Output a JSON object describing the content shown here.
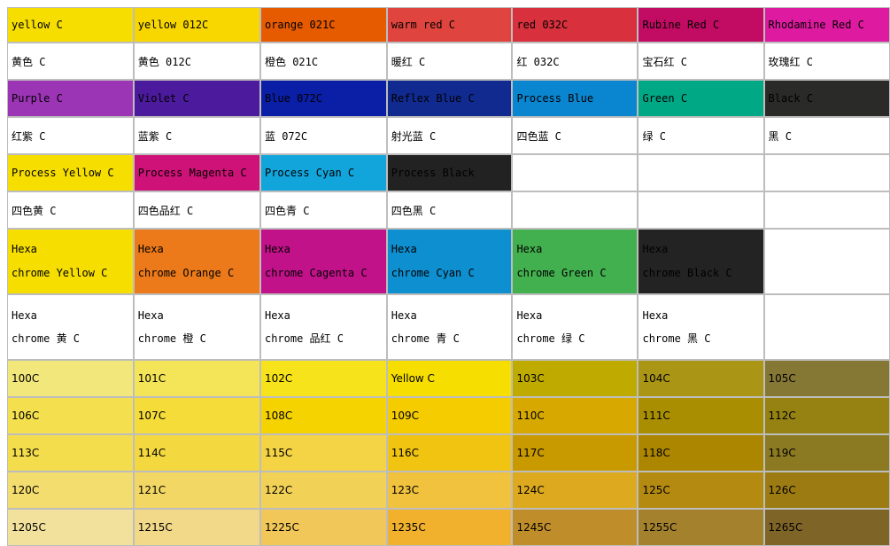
{
  "rows": [
    {
      "kind": "swatch",
      "h": 38,
      "cells": [
        {
          "text": "yellow C",
          "bg": "#f6de00"
        },
        {
          "text": "yellow 012C",
          "bg": "#f8d700"
        },
        {
          "text": "orange 021C",
          "bg": "#e65a00"
        },
        {
          "text": "warm red C",
          "bg": "#e0443e"
        },
        {
          "text": "red 032C",
          "bg": "#d9303d"
        },
        {
          "text": "Rubine Red C",
          "bg": "#c20b63"
        },
        {
          "text": "Rhodamine Red C",
          "bg": "#de1aa0"
        }
      ]
    },
    {
      "kind": "label",
      "h": 40,
      "cells": [
        {
          "text": "黄色 C"
        },
        {
          "text": "黄色 012C"
        },
        {
          "text": "橙色 021C"
        },
        {
          "text": "暖红 C"
        },
        {
          "text": "红 032C"
        },
        {
          "text": "宝石红 C"
        },
        {
          "text": "玫瑰红 C"
        }
      ]
    },
    {
      "kind": "swatch",
      "h": 40,
      "cells": [
        {
          "text": "Purple C",
          "bg": "#9c35b5"
        },
        {
          "text": "Violet C",
          "bg": "#4c1a9c"
        },
        {
          "text": "Blue 072C",
          "bg": "#0b1ea6"
        },
        {
          "text": "Reflex Blue C",
          "bg": "#102a8f"
        },
        {
          "text": "Process Blue",
          "bg": "#0a85cf"
        },
        {
          "text": "Green C",
          "bg": "#00a886"
        },
        {
          "text": "Black C",
          "bg": "#2a2a28"
        }
      ]
    },
    {
      "kind": "label",
      "h": 40,
      "cells": [
        {
          "text": "红紫 C"
        },
        {
          "text": "蓝紫 C"
        },
        {
          "text": "蓝 072C"
        },
        {
          "text": "射光蓝 C"
        },
        {
          "text": "四色蓝 C"
        },
        {
          "text": "绿 C"
        },
        {
          "text": "黑 C"
        }
      ]
    },
    {
      "kind": "swatch",
      "h": 40,
      "cells": [
        {
          "text": "Process Yellow C",
          "bg": "#f6de00"
        },
        {
          "text": "Process Magenta C",
          "bg": "#cf1277"
        },
        {
          "text": "Process Cyan C",
          "bg": "#12a5dc"
        },
        {
          "text": "Process Black",
          "bg": "#222222"
        },
        {
          "text": "",
          "bg": ""
        },
        {
          "text": "",
          "bg": ""
        },
        {
          "text": "",
          "bg": ""
        }
      ]
    },
    {
      "kind": "label",
      "h": 40,
      "cells": [
        {
          "text": "四色黄 C"
        },
        {
          "text": "四色品红 C"
        },
        {
          "text": "四色青 C"
        },
        {
          "text": "四色黑 C"
        },
        {
          "text": ""
        },
        {
          "text": ""
        },
        {
          "text": ""
        }
      ]
    },
    {
      "kind": "tall",
      "h": 72,
      "cells": [
        {
          "text": "Hexa\nchrome Yellow C",
          "bg": "#f6de00"
        },
        {
          "text": "Hexa\nchrome Orange C",
          "bg": "#ec7a1a"
        },
        {
          "text": "Hexa\nchrome Cagenta C",
          "bg": "#c2128a"
        },
        {
          "text": "Hexa\nchrome Cyan C",
          "bg": "#0e8fd0"
        },
        {
          "text": "Hexa\nchrome Green C",
          "bg": "#43b04f"
        },
        {
          "text": "Hexa\nchrome Black C",
          "bg": "#232323"
        },
        {
          "text": "",
          "bg": ""
        }
      ]
    },
    {
      "kind": "tall-lbl",
      "h": 72,
      "cells": [
        {
          "text": "Hexa\nchrome 黄 C"
        },
        {
          "text": "Hexa\nchrome 橙 C"
        },
        {
          "text": "Hexa\nchrome 品红 C"
        },
        {
          "text": "Hexa\nchrome 青 C"
        },
        {
          "text": "Hexa\nchrome 绿 C"
        },
        {
          "text": "Hexa\nchrome 黑 C"
        },
        {
          "text": ""
        }
      ]
    },
    {
      "kind": "code",
      "h": 40,
      "cells": [
        {
          "text": "100C",
          "bg": "#f2e77a"
        },
        {
          "text": "101C",
          "bg": "#f4e458"
        },
        {
          "text": "102C",
          "bg": "#f6e31c"
        },
        {
          "text": "Yellow C",
          "bg": "#f6de00"
        },
        {
          "text": "103C",
          "bg": "#bfaa00"
        },
        {
          "text": "104C",
          "bg": "#ab9514"
        },
        {
          "text": "105C",
          "bg": "#857734"
        }
      ]
    },
    {
      "kind": "code",
      "h": 40,
      "cells": [
        {
          "text": "106C",
          "bg": "#f4e04e"
        },
        {
          "text": "107C",
          "bg": "#f5dc38"
        },
        {
          "text": "108C",
          "bg": "#f5d300"
        },
        {
          "text": "109C",
          "bg": "#f5cc00"
        },
        {
          "text": "110C",
          "bg": "#d7a900"
        },
        {
          "text": "111C",
          "bg": "#a88e00"
        },
        {
          "text": "112C",
          "bg": "#958213"
        }
      ]
    },
    {
      "kind": "code",
      "h": 40,
      "cells": [
        {
          "text": "113C",
          "bg": "#f4dd4c"
        },
        {
          "text": "114C",
          "bg": "#f4d840"
        },
        {
          "text": "115C",
          "bg": "#f4d345"
        },
        {
          "text": "116C",
          "bg": "#f2c412"
        },
        {
          "text": "117C",
          "bg": "#c99a00"
        },
        {
          "text": "118C",
          "bg": "#ad8600"
        },
        {
          "text": "119C",
          "bg": "#8c7a22"
        }
      ]
    },
    {
      "kind": "code",
      "h": 40,
      "cells": [
        {
          "text": "120C",
          "bg": "#f3dd6e"
        },
        {
          "text": "121C",
          "bg": "#f3d764"
        },
        {
          "text": "122C",
          "bg": "#f2d157"
        },
        {
          "text": "123C",
          "bg": "#f1c23e"
        },
        {
          "text": "124C",
          "bg": "#dca91f"
        },
        {
          "text": "125C",
          "bg": "#b48a10"
        },
        {
          "text": "126C",
          "bg": "#9c7c12"
        }
      ]
    },
    {
      "kind": "code",
      "h": 40,
      "cells": [
        {
          "text": "1205C",
          "bg": "#f2e19c"
        },
        {
          "text": "1215C",
          "bg": "#f2d889"
        },
        {
          "text": "1225C",
          "bg": "#f2c75a"
        },
        {
          "text": "1235C",
          "bg": "#f1b12d"
        },
        {
          "text": "1245C",
          "bg": "#bf8e2a"
        },
        {
          "text": "1255C",
          "bg": "#a4812d"
        },
        {
          "text": "1265C",
          "bg": "#7f6427"
        }
      ]
    }
  ]
}
